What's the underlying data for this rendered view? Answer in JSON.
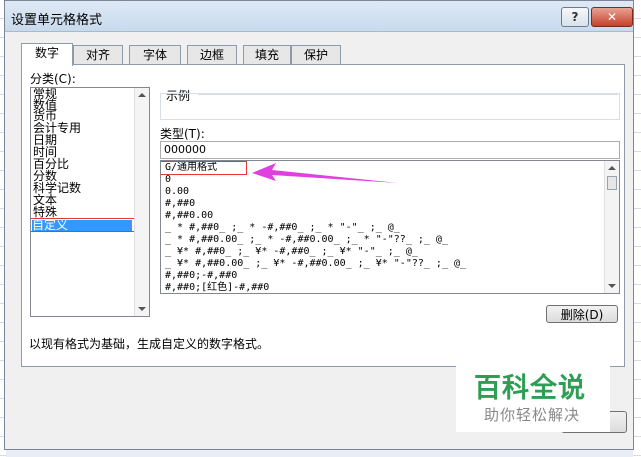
{
  "dialog": {
    "title": "设置单元格格式",
    "help_label": "?",
    "close_label": "✕"
  },
  "tabs": [
    "数字",
    "对齐",
    "字体",
    "边框",
    "填充",
    "保护"
  ],
  "category": {
    "label": "分类(C):",
    "items": [
      "常规",
      "数值",
      "货币",
      "会计专用",
      "日期",
      "时间",
      "百分比",
      "分数",
      "科学记数",
      "文本",
      "特殊",
      "自定义"
    ],
    "selected": "自定义"
  },
  "sample": {
    "label": "示例"
  },
  "type": {
    "label": "类型(T):",
    "value": "000000"
  },
  "formats": [
    "G/通用格式",
    "0",
    "0.00",
    "#,##0",
    "#,##0.00",
    "_ * #,##0_ ;_ * -#,##0_ ;_ * \"-\"_ ;_ @_",
    "_ * #,##0.00_ ;_ * -#,##0.00_ ;_ * \"-\"??_ ;_ @_",
    "_ ¥* #,##0_ ;_ ¥* -#,##0_ ;_ ¥* \"-\"_ ;_ @_",
    "_ ¥* #,##0.00_ ;_ ¥* -#,##0.00_ ;_ ¥* \"-\"??_ ;_ @_",
    "#,##0;-#,##0",
    "#,##0;[红色]-#,##0"
  ],
  "delete_label": "删除(D)",
  "description": "以现有格式为基础，生成自定义的数字格式。",
  "watermark": {
    "main": "百科全说",
    "sub": "助你轻松解决"
  },
  "colors": {
    "highlight": "#e03a3a",
    "arrow": "#e040e0",
    "selection": "#3399ff",
    "watermark": "#2e9e55"
  }
}
